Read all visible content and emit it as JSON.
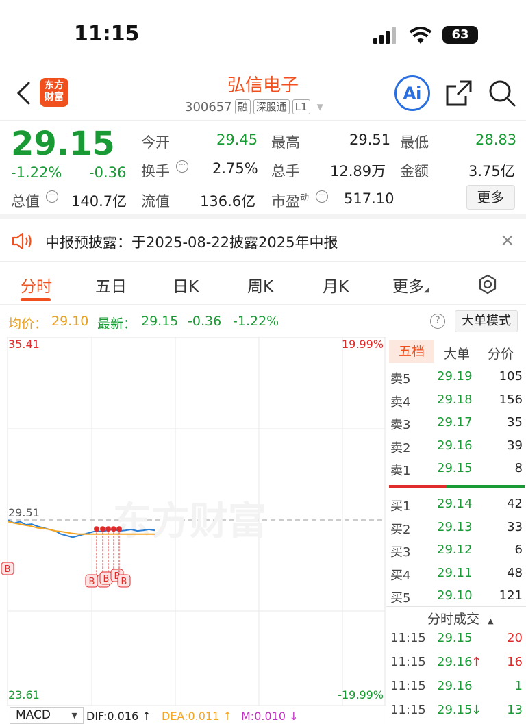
{
  "status": {
    "time": "11:15",
    "battery": "63"
  },
  "nav": {
    "logo_line1": "东方",
    "logo_line2": "财富",
    "stock_name": "弘信电子",
    "code": "300657",
    "tag1": "融",
    "tag2": "深股通",
    "tag3": "L1",
    "ai_label": "Ai"
  },
  "quote": {
    "price": "29.15",
    "change_pct": "-1.22%",
    "change": "-0.36",
    "open_label": "今开",
    "open": "29.45",
    "high_label": "最高",
    "high": "29.51",
    "low_label": "最低",
    "low": "28.83",
    "turnover_label": "换手",
    "turnover": "2.75%",
    "volume_label": "总手",
    "volume": "12.89万",
    "amount_label": "金额",
    "amount": "3.75亿",
    "mktcap_label": "总值",
    "mktcap": "140.7亿",
    "float_label": "流值",
    "float": "136.6亿",
    "pe_label": "市盈",
    "pe_sup": "动",
    "pe": "517.10",
    "more": "更多"
  },
  "notice": {
    "text": "中报预披露：于2025-08-22披露2025年中报"
  },
  "tabs": [
    "分时",
    "五日",
    "日K",
    "周K",
    "月K",
    "更多"
  ],
  "chartinfo": {
    "avg_label": "均价：",
    "avg": "29.10",
    "latest_label": "最新：",
    "latest": "29.15",
    "change": "-0.36",
    "change_pct": "-1.22%",
    "mode_button": "大单模式"
  },
  "chart": {
    "y_top": "35.41",
    "y_top_pct": "19.99%",
    "y_bottom": "23.61",
    "y_bottom_pct": "-19.99%",
    "ref_price": "29.51",
    "watermark": "东方财富",
    "marker_b": "B"
  },
  "chart_data": {
    "type": "line",
    "ylim": [
      23.61,
      35.41
    ],
    "reference": 29.51,
    "series": [
      {
        "values": [
          29.55,
          29.45,
          29.5,
          29.4,
          29.42,
          29.35,
          29.3,
          29.25,
          29.2,
          29.1,
          29.05,
          29.0,
          29.05,
          29.1,
          29.15,
          29.2,
          29.18,
          29.22,
          29.25,
          29.2,
          29.22,
          29.25,
          29.2,
          29.22,
          29.25,
          29.22
        ]
      },
      {
        "values": [
          29.5,
          29.45,
          29.42,
          29.38,
          29.35,
          29.3,
          29.28,
          29.25,
          29.2,
          29.18,
          29.15,
          29.12,
          29.1,
          29.1,
          29.1,
          29.1,
          29.1,
          29.1,
          29.1,
          29.1,
          29.1,
          29.1,
          29.1,
          29.1,
          29.1,
          29.1
        ]
      }
    ]
  },
  "orderbook": {
    "tabs": [
      "五档",
      "大单",
      "分价"
    ],
    "sells": [
      {
        "label": "卖5",
        "price": "29.19",
        "vol": "105"
      },
      {
        "label": "卖4",
        "price": "29.18",
        "vol": "156"
      },
      {
        "label": "卖3",
        "price": "29.17",
        "vol": "35"
      },
      {
        "label": "卖2",
        "price": "29.16",
        "vol": "39"
      },
      {
        "label": "卖1",
        "price": "29.15",
        "vol": "8"
      }
    ],
    "buys": [
      {
        "label": "买1",
        "price": "29.14",
        "vol": "42"
      },
      {
        "label": "买2",
        "price": "29.13",
        "vol": "33"
      },
      {
        "label": "买3",
        "price": "29.12",
        "vol": "6"
      },
      {
        "label": "买4",
        "price": "29.11",
        "vol": "48"
      },
      {
        "label": "买5",
        "price": "29.10",
        "vol": "121"
      }
    ],
    "trades_title": "分时成交",
    "trades": [
      {
        "time": "11:15",
        "price": "29.15",
        "vol": "20",
        "arrow": ""
      },
      {
        "time": "11:15",
        "price": "29.16",
        "vol": "16",
        "arrow": "↑"
      },
      {
        "time": "11:15",
        "price": "29.16",
        "vol": "1",
        "arrow": ""
      },
      {
        "time": "11:15",
        "price": "29.15",
        "vol": "13",
        "arrow": "↓"
      }
    ]
  },
  "macd": {
    "selector": "MACD",
    "dif": "DIF:0.016 ↑",
    "dea": "DEA:0.011 ↑",
    "m": "M:0.010 ↓"
  },
  "colors": {
    "up": "#e02b2b",
    "down": "#1a9a35",
    "brand": "#f0501e",
    "avg_line": "#f5a623",
    "price_line": "#2a7fd4"
  }
}
